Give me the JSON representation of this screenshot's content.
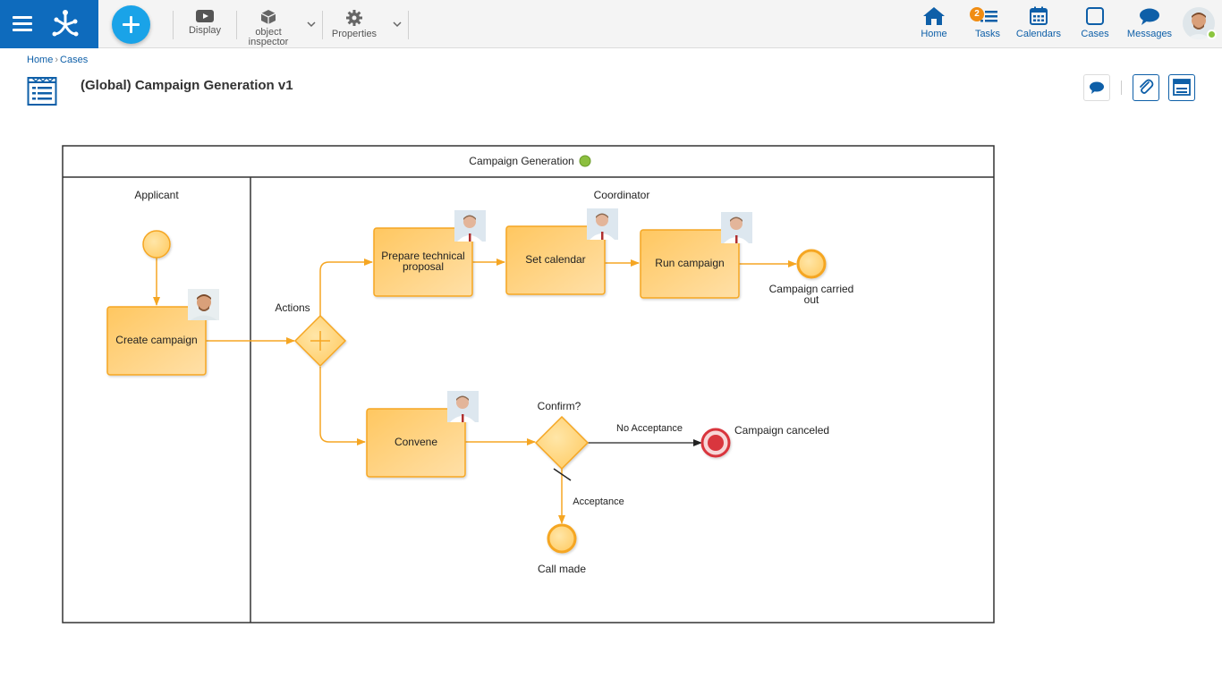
{
  "toolbar": {
    "display_label": "Display",
    "object_inspector_label_1": "object",
    "object_inspector_label_2": "inspector",
    "properties_label": "Properties"
  },
  "nav": {
    "home": "Home",
    "tasks": "Tasks",
    "tasks_badge": "2",
    "calendars": "Calendars",
    "cases": "Cases",
    "messages": "Messages"
  },
  "breadcrumb": {
    "home": "Home",
    "separator": "›",
    "cases": "Cases"
  },
  "page": {
    "title": "(Global) Campaign Generation v1"
  },
  "colors": {
    "brand": "#0e6bbd",
    "accent": "#1aa3e8",
    "task_fill": "#ffcf7a",
    "task_border": "#f5a623",
    "end_canceled": "#d9363e",
    "status_online": "#8cc63f",
    "badge": "#f08c12"
  },
  "diagram": {
    "pool_title": "Campaign Generation",
    "lanes": {
      "applicant": "Applicant",
      "coordinator": "Coordinator"
    },
    "tasks": {
      "create_campaign": "Create campaign",
      "prepare_line1": "Prepare technical",
      "prepare_line2": "proposal",
      "set_calendar": "Set calendar",
      "run_campaign": "Run campaign",
      "convene": "Convene"
    },
    "gateways": {
      "actions": "Actions",
      "confirm": "Confirm?"
    },
    "flows": {
      "no_acceptance": "No Acceptance",
      "acceptance": "Acceptance"
    },
    "events": {
      "carried_out_line1": "Campaign carried",
      "carried_out_line2": "out",
      "canceled": "Campaign canceled",
      "call_made": "Call made"
    }
  }
}
